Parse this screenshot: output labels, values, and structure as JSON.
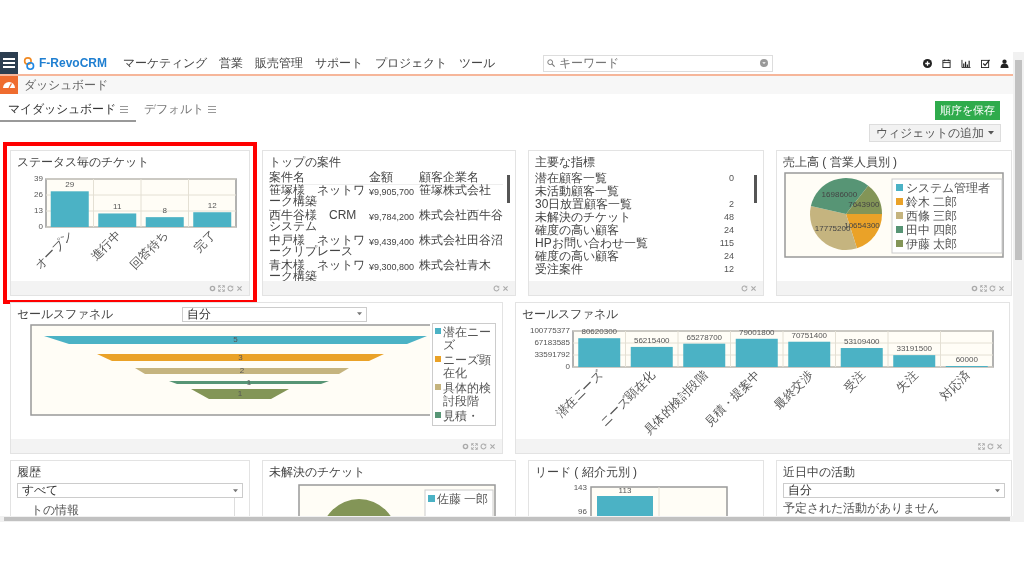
{
  "header": {
    "logo": "F-RevoCRM",
    "menu": [
      "マーケティング",
      "営業",
      "販売管理",
      "サポート",
      "プロジェクト",
      "ツール"
    ],
    "search": {
      "placeholder": "キーワード"
    }
  },
  "breadcrumb": "ダッシュボード",
  "tabs": [
    {
      "label": "マイダッシュボード",
      "selected": true
    },
    {
      "label": "デフォルト",
      "selected": false
    }
  ],
  "save_button": "順序を保存",
  "add_widget_button": "ウィジェットの追加",
  "widgets": [
    {
      "kind": "bar_chart",
      "title": "ステータス毎のチケット",
      "highlighted": true,
      "tools": {
        "settings": true,
        "expand": true
      },
      "chart_data": {
        "type": "bar",
        "categories": [
          "オープン",
          "進行中",
          "回答待ち",
          "完了"
        ],
        "values": [
          29,
          11,
          8,
          12
        ],
        "ylim": [
          0,
          39
        ],
        "yticks": [
          0,
          13,
          26,
          39
        ],
        "data_labels": true
      }
    },
    {
      "kind": "table",
      "title": "トップの案件",
      "highlighted": false,
      "tools": {
        "settings": false,
        "expand": false
      },
      "table": {
        "columns": [
          "案件名",
          "金額",
          "顧客企業名"
        ],
        "rows": [
          [
            "笹塚様　ネットワーク構築",
            "¥9,905,700",
            "笹塚株式会社"
          ],
          [
            "西牛谷様　CRMシステム",
            "¥9,784,200",
            "株式会社西牛谷"
          ],
          [
            "中戸様　ネットワークリプレース",
            "¥9,439,400",
            "株式会社田谷沼"
          ],
          [
            "青木様　ネットワーク構築",
            "¥9,300,800",
            "株式会社青木"
          ]
        ]
      }
    },
    {
      "kind": "metrics",
      "title": "主要な指標",
      "highlighted": false,
      "tools": {
        "settings": false,
        "expand": false
      },
      "metrics": [
        {
          "label": "潜在顧客一覧",
          "count": "0"
        },
        {
          "label": "未活動顧客一覧"
        },
        {
          "label": "30日放置顧客一覧",
          "count": "2"
        },
        {
          "label": "未解決のチケット",
          "count": "48"
        },
        {
          "label": "確度の高い顧客",
          "count": "24"
        },
        {
          "label": "HPお問い合わせ一覧",
          "count": "115"
        },
        {
          "label": "確度の高い顧客",
          "count": "24"
        },
        {
          "label": "受注案件",
          "count": "12"
        }
      ]
    },
    {
      "kind": "pie_chart",
      "title": "売上高 ( 営業人員別 )",
      "highlighted": false,
      "tools": {
        "settings": true,
        "expand": true
      },
      "chart_data": {
        "type": "pie",
        "categories": [
          "システム管理者",
          "鈴木 二郎",
          "西條 三郎",
          "田中 四郎",
          "伊藤 太郎"
        ],
        "values": [
          null,
          10654300,
          17775200,
          16986000,
          7643900
        ],
        "data_labels": true,
        "legend": "right"
      }
    },
    {
      "kind": "funnel",
      "title": "セールスファネル",
      "filter": "自分",
      "highlighted": false,
      "tools": {
        "settings": true,
        "expand": true
      },
      "funnel": {
        "stages": [
          {
            "label": "5",
            "color": "#4bb2c5"
          },
          {
            "label": "3",
            "color": "#eaa228"
          },
          {
            "label": "2",
            "color": "#c5b47f"
          },
          {
            "label": "1",
            "color": "#579575"
          },
          {
            "label": "1",
            "color": "#839557"
          }
        ],
        "legend": [
          {
            "label": "潜在ニーズ",
            "color": "#4bb2c5"
          },
          {
            "label": "ニーズ顕在化",
            "color": "#eaa228"
          },
          {
            "label": "具体的検討段階",
            "color": "#c5b47f"
          },
          {
            "label": "見積・",
            "color": "#579575"
          }
        ]
      }
    },
    {
      "kind": "bar_chart",
      "title": "セールスファネル",
      "highlighted": false,
      "tools": {
        "settings": false,
        "expand": true
      },
      "chart_data": {
        "type": "bar",
        "categories": [
          "潜在ニーズ",
          "ニーズ顕在化",
          "具体的検討段階",
          "見積・提案中",
          "最終交渉",
          "受注",
          "失注",
          "対応済"
        ],
        "values": [
          80620300,
          56215400,
          65278700,
          79001800,
          70751400,
          53109400,
          33191500,
          60000
        ],
        "ylim": [
          0,
          100775377
        ],
        "yticks": [
          0,
          33591792,
          67183585,
          100775377
        ],
        "data_labels": true
      }
    },
    {
      "kind": "history",
      "title": "履歴",
      "filter": "すべて",
      "highlighted": false,
      "items": [
        "トの情報"
      ]
    },
    {
      "kind": "pie_picture",
      "title": "未解決のチケット",
      "highlighted": false,
      "legend": [
        {
          "label": "佐藤 一郎",
          "color": "#4bb2c5"
        }
      ]
    },
    {
      "kind": "partial_bar_chart",
      "title": "リード ( 紹介元別 )",
      "highlighted": false,
      "axis_labels": [
        "143",
        "96"
      ],
      "bar_labels": [
        "113"
      ]
    },
    {
      "kind": "activities",
      "title": "近日中の活動",
      "filter": "自分",
      "highlighted": false,
      "message": "予定された活動がありません"
    }
  ]
}
